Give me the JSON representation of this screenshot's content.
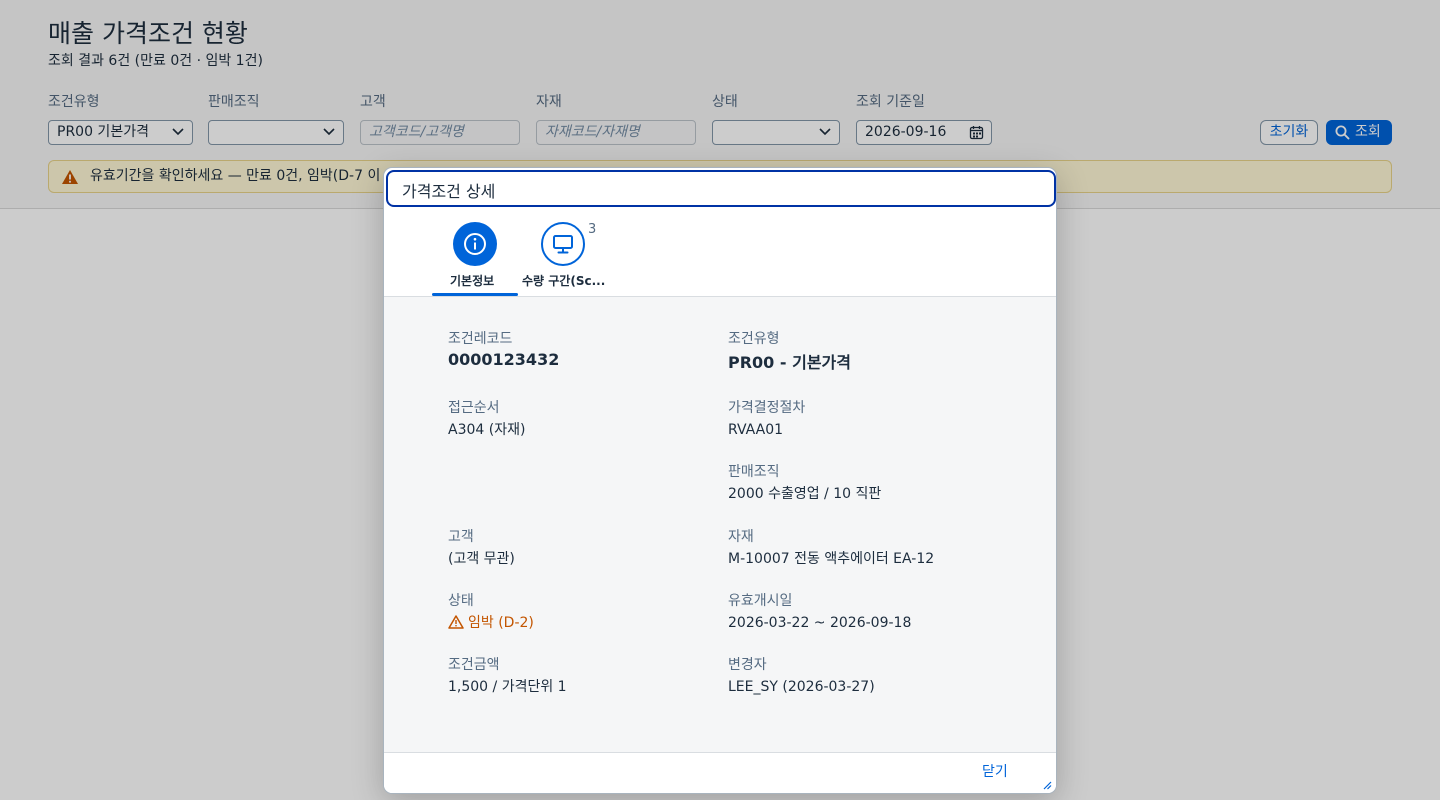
{
  "page": {
    "title": "매출 가격조건 현황",
    "subtitle": "조회 결과 6건 (만료 0건 · 임박 1건)"
  },
  "filters": {
    "condition_type": {
      "label": "조건유형",
      "value": "PR00 기본가격"
    },
    "sales_org": {
      "label": "판매조직",
      "value": ""
    },
    "customer": {
      "label": "고객",
      "placeholder": "고객코드/고객명"
    },
    "material": {
      "label": "자재",
      "placeholder": "자재코드/자재명"
    },
    "status": {
      "label": "상태",
      "value": ""
    },
    "ref_date": {
      "label": "조회 기준일",
      "value": "2026-09-16"
    }
  },
  "toolbar": {
    "reset_label": "초기화",
    "search_label": "조회"
  },
  "warning_strip": {
    "message": "유효기간을 확인하세요 — 만료 0건, 임박(D-7 이"
  },
  "dialog": {
    "title": "가격조건 상세",
    "tabs": [
      {
        "label": "기본정보",
        "icon": "info-icon",
        "selected": true
      },
      {
        "label": "수량 구간(Sc...",
        "icon": "monitor-icon",
        "count": "3",
        "selected": false
      }
    ],
    "fields": {
      "record_code": {
        "label": "조건레코드",
        "value": "0000123432"
      },
      "condition_type": {
        "label": "조건유형",
        "value": "PR00 - 기본가격"
      },
      "access_seq": {
        "label": "접근순서",
        "value": "A304 (자재)"
      },
      "pricing_proc": {
        "label": "가격결정절차",
        "value": "RVAA01"
      },
      "sales_org": {
        "label": "판매조직",
        "value": "2000 수출영업 / 10 직판"
      },
      "customer": {
        "label": "고객",
        "value": "(고객 무관)"
      },
      "material": {
        "label": "자재",
        "value": "M-10007 전동 액추에이터 EA-12"
      },
      "status": {
        "label": "상태",
        "value": "임박 (D-2)"
      },
      "validity": {
        "label": "유효개시일",
        "value": "2026-03-22 ~ 2026-09-18"
      },
      "amount": {
        "label": "조건금액",
        "value": "1,500 / 가격단위 1"
      },
      "changed_by": {
        "label": "변경자",
        "value": "LEE_SY (2026-03-27)"
      }
    },
    "close_label": "닫기"
  },
  "colors": {
    "accent": "#0064d9",
    "warning": "#c35500",
    "header_focus": "#0032a5",
    "body_bg": "#f5f6f7"
  }
}
